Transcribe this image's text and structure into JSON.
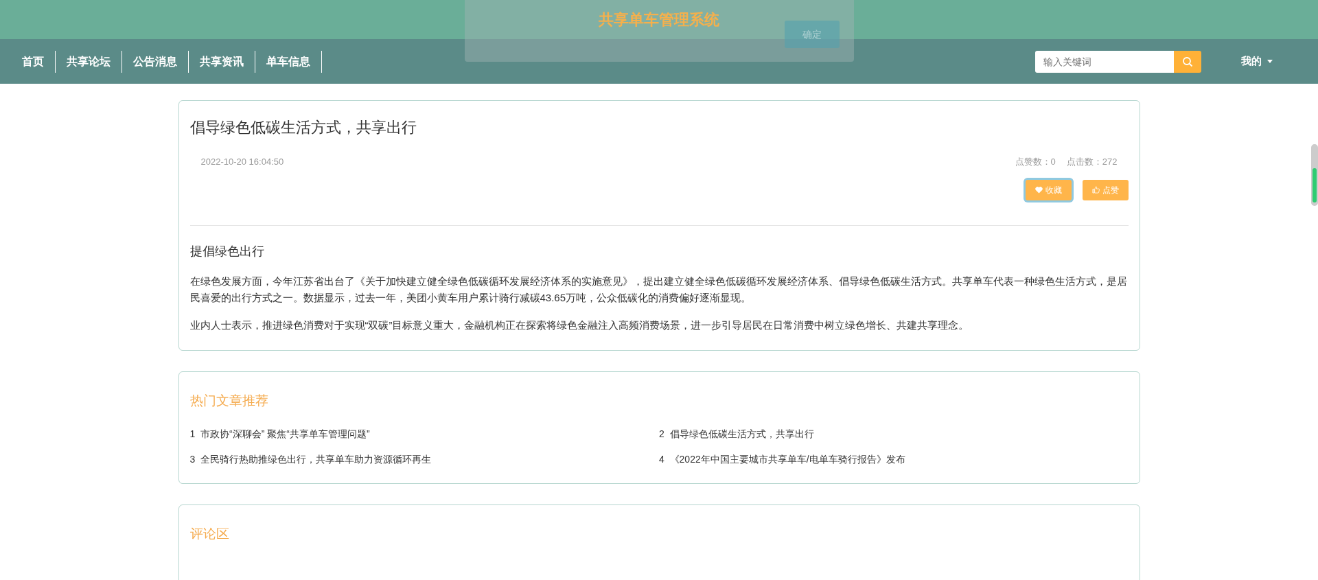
{
  "header": {
    "title": "共享单车管理系统"
  },
  "nav": {
    "items": [
      {
        "label": "首页"
      },
      {
        "label": "共享论坛"
      },
      {
        "label": "公告消息"
      },
      {
        "label": "共享资讯"
      },
      {
        "label": "单车信息"
      }
    ],
    "search": {
      "placeholder": "输入关键词"
    },
    "user_menu": "我的"
  },
  "dialog": {
    "button": "确定"
  },
  "article": {
    "title": "倡导绿色低碳生活方式，共享出行",
    "time": "2022-10-20 16:04:50",
    "likes_label": "点赞数：0",
    "clicks_label": "点击数：272",
    "buttons": [
      {
        "label": "收藏",
        "kind": "favorite",
        "focused": true
      },
      {
        "label": "点赞",
        "kind": "like",
        "focused": false
      }
    ],
    "subtitle": "提倡绿色出行",
    "paragraphs": [
      "在绿色发展方面，今年江苏省出台了《关于加快建立健全绿色低碳循环发展经济体系的实施意见》，提出建立健全绿色低碳循环发展经济体系、倡导绿色低碳生活方式。共享单车代表一种绿色生活方式，是居民喜爱的出行方式之一。数据显示，过去一年，美团小黄车用户累计骑行减碳43.65万吨，公众低碳化的消费偏好逐渐显现。",
      "业内人士表示，推进绿色消费对于实现“双碳”目标意义重大，金融机构正在探索将绿色金融注入高频消费场景，进一步引导居民在日常消费中树立绿色增长、共建共享理念。"
    ]
  },
  "hot": {
    "title": "热门文章推荐",
    "items": [
      {
        "index": "1",
        "title": "市政协“深聊会” 聚焦“共享单车管理问题”"
      },
      {
        "index": "2",
        "title": "倡导绿色低碳生活方式，共享出行"
      },
      {
        "index": "3",
        "title": "全民骑行热助推绿色出行，共享单车助力资源循环再生"
      },
      {
        "index": "4",
        "title": "《2022年中国主要城市共享单车/电单车骑行报告》发布"
      }
    ]
  },
  "comments": {
    "title": "评论区"
  }
}
